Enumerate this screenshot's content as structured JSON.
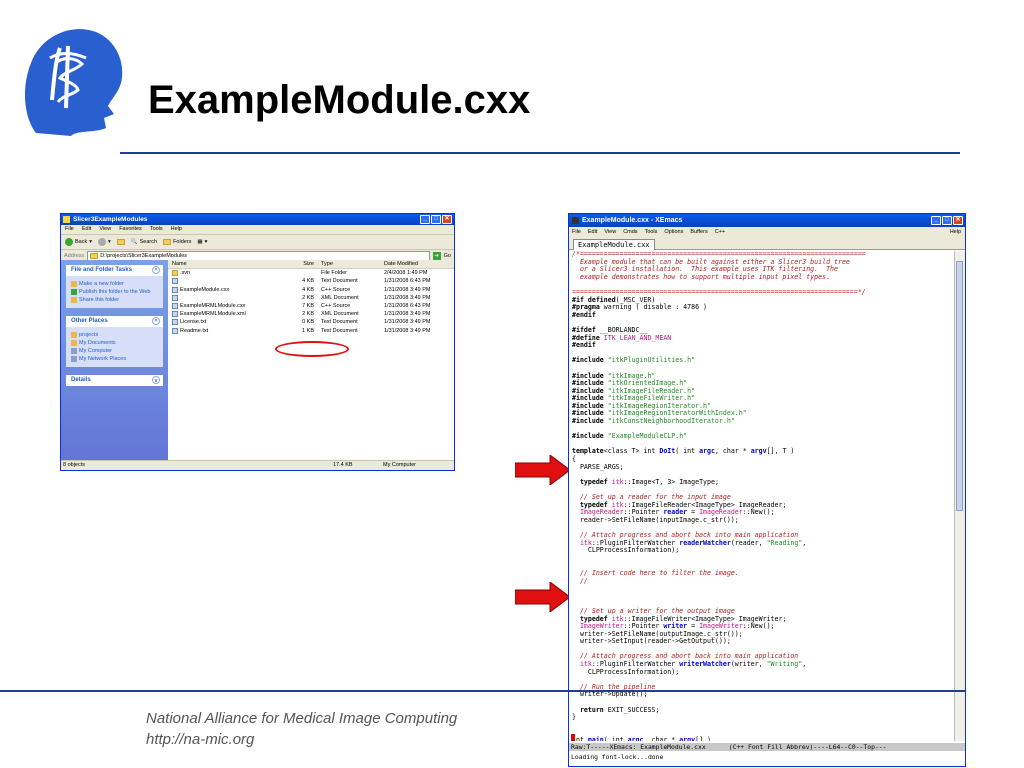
{
  "slide": {
    "title": "ExampleModule.cxx",
    "footer_line1": "National Alliance for Medical Image Computing",
    "footer_line2": "http://na-mic.org"
  },
  "explorer": {
    "title": "Slicer3ExampleModules",
    "menu": [
      "File",
      "Edit",
      "View",
      "Favorites",
      "Tools",
      "Help"
    ],
    "toolbar": {
      "back": "Back",
      "search": "Search",
      "folders": "Folders"
    },
    "address_label": "Address",
    "address_value": "D:\\projects\\Slicer3ExampleModules",
    "go_label": "Go",
    "tasks_header": "File and Folder Tasks",
    "tasks": [
      "Make a new folder",
      "Publish this folder to the Web",
      "Share this folder"
    ],
    "other_places_header": "Other Places",
    "other_places": [
      "projects",
      "My Documents",
      "My Computer",
      "My Network Places"
    ],
    "details_header": "Details",
    "columns": {
      "name": "Name",
      "size": "Size",
      "type": "Type",
      "date": "Date Modified"
    },
    "files": [
      {
        "name": ".svn",
        "size": "",
        "type": "File Folder",
        "date": "2/4/2008 1:49 PM",
        "folder": true
      },
      {
        "name": "",
        "size": "4 KB",
        "type": "Text Document",
        "date": "1/31/2008 6:43 PM"
      },
      {
        "name": "ExampleModule.cxx",
        "size": "4 KB",
        "type": "C++ Source",
        "date": "1/31/2008 3:49 PM"
      },
      {
        "name": "",
        "size": "2 KB",
        "type": "XML Document",
        "date": "1/31/2008 3:49 PM"
      },
      {
        "name": "ExampleMRMLModule.cxx",
        "size": "7 KB",
        "type": "C++ Source",
        "date": "1/31/2008 6:43 PM"
      },
      {
        "name": "ExampleMRMLModule.xml",
        "size": "2 KB",
        "type": "XML Document",
        "date": "1/31/2008 3:49 PM"
      },
      {
        "name": "License.txt",
        "size": "0 KB",
        "type": "Text Document",
        "date": "1/31/2008 3:49 PM"
      },
      {
        "name": "Readme.txt",
        "size": "1 KB",
        "type": "Text Document",
        "date": "1/31/2008 3:49 PM"
      }
    ],
    "status_objects": "8 objects",
    "status_size": "17.4 KB",
    "status_location": "My Computer"
  },
  "emacs": {
    "title": "ExampleModule.cxx - XEmacs",
    "menu": [
      "File",
      "Edit",
      "View",
      "Cmds",
      "Tools",
      "Options",
      "Buffers",
      "C++"
    ],
    "help": "Help",
    "tab": "ExampleModule.cxx",
    "modeline": "Raw:T-----XEmacs: ExampleModule.cxx      (C++ Font Fill Abbrev)----L64--C0--Top---",
    "echo": "Loading font-lock...done",
    "code": [
      [
        [
          "c",
          "/*========================================================================"
        ]
      ],
      [
        [
          "c",
          "  Example module that can be built against either a Slicer3 build tree"
        ]
      ],
      [
        [
          "c",
          "  or a Slicer3 installation.  This example uses ITK filtering.  The"
        ]
      ],
      [
        [
          "c",
          "  example demonstrates how to support multiple input pixel types."
        ]
      ],
      [
        [
          "n",
          ""
        ]
      ],
      [
        [
          "c",
          "========================================================================*/"
        ]
      ],
      [
        [
          "k",
          "#if defined"
        ],
        [
          "n",
          "(_MSC_VER)"
        ]
      ],
      [
        [
          "k",
          "#pragma"
        ],
        [
          "n",
          " warning ( disable : 4786 )"
        ]
      ],
      [
        [
          "k",
          "#endif"
        ]
      ],
      [
        [
          "n",
          ""
        ]
      ],
      [
        [
          "k",
          "#ifdef"
        ],
        [
          "n",
          " __BORLANDC__"
        ]
      ],
      [
        [
          "k",
          "#define"
        ],
        [
          "n",
          " "
        ],
        [
          "t",
          "ITK_LEAN_AND_MEAN"
        ]
      ],
      [
        [
          "k",
          "#endif"
        ]
      ],
      [
        [
          "n",
          ""
        ]
      ],
      [
        [
          "k",
          "#include"
        ],
        [
          "n",
          " "
        ],
        [
          "s",
          "\"itkPluginUtilities.h\""
        ]
      ],
      [
        [
          "n",
          ""
        ]
      ],
      [
        [
          "k",
          "#include"
        ],
        [
          "n",
          " "
        ],
        [
          "s",
          "\"itkImage.h\""
        ]
      ],
      [
        [
          "k",
          "#include"
        ],
        [
          "n",
          " "
        ],
        [
          "s",
          "\"itkOrientedImage.h\""
        ]
      ],
      [
        [
          "k",
          "#include"
        ],
        [
          "n",
          " "
        ],
        [
          "s",
          "\"itkImageFileReader.h\""
        ]
      ],
      [
        [
          "k",
          "#include"
        ],
        [
          "n",
          " "
        ],
        [
          "s",
          "\"itkImageFileWriter.h\""
        ]
      ],
      [
        [
          "k",
          "#include"
        ],
        [
          "n",
          " "
        ],
        [
          "s",
          "\"itkImageRegionIterator.h\""
        ]
      ],
      [
        [
          "k",
          "#include"
        ],
        [
          "n",
          " "
        ],
        [
          "s",
          "\"itkImageRegionIteratorWithIndex.h\""
        ]
      ],
      [
        [
          "k",
          "#include"
        ],
        [
          "n",
          " "
        ],
        [
          "s",
          "\"itkConstNeighborhoodIterator.h\""
        ]
      ],
      [
        [
          "n",
          ""
        ]
      ],
      [
        [
          "k",
          "#include"
        ],
        [
          "n",
          " "
        ],
        [
          "s",
          "\"ExampleModuleCLP.h\""
        ]
      ],
      [
        [
          "n",
          ""
        ]
      ],
      [
        [
          "k",
          "template"
        ],
        [
          "n",
          "<class T> int "
        ],
        [
          "f",
          "DoIt"
        ],
        [
          "n",
          "( int "
        ],
        [
          "f",
          "argc"
        ],
        [
          "n",
          ", char * "
        ],
        [
          "f",
          "argv"
        ],
        [
          "n",
          "[], T )"
        ]
      ],
      [
        [
          "n",
          "{"
        ]
      ],
      [
        [
          "n",
          "  PARSE_ARGS;"
        ]
      ],
      [
        [
          "n",
          ""
        ]
      ],
      [
        [
          "n",
          "  "
        ],
        [
          "k",
          "typedef"
        ],
        [
          "n",
          " "
        ],
        [
          "t",
          "itk"
        ],
        [
          "n",
          "::Image<T, 3> ImageType;"
        ]
      ],
      [
        [
          "n",
          ""
        ]
      ],
      [
        [
          "c",
          "  // Set up a reader for the input image"
        ]
      ],
      [
        [
          "n",
          "  "
        ],
        [
          "k",
          "typedef"
        ],
        [
          "n",
          " "
        ],
        [
          "t",
          "itk"
        ],
        [
          "n",
          "::ImageFileReader<ImageType> ImageReader;"
        ]
      ],
      [
        [
          "n",
          "  "
        ],
        [
          "t",
          "ImageReader"
        ],
        [
          "n",
          "::Pointer "
        ],
        [
          "f",
          "reader"
        ],
        [
          "n",
          " = "
        ],
        [
          "t",
          "ImageReader"
        ],
        [
          "n",
          "::New();"
        ]
      ],
      [
        [
          "n",
          "  reader->SetFileName(inputImage.c_str());"
        ]
      ],
      [
        [
          "n",
          ""
        ]
      ],
      [
        [
          "c",
          "  // Attach progress and abort back into main application"
        ]
      ],
      [
        [
          "n",
          "  "
        ],
        [
          "t",
          "itk"
        ],
        [
          "n",
          "::PluginFilterWatcher "
        ],
        [
          "f",
          "readerWatcher"
        ],
        [
          "n",
          "(reader, "
        ],
        [
          "s",
          "\"Reading\""
        ],
        [
          "n",
          ","
        ]
      ],
      [
        [
          "n",
          "    CLPProcessInformation);"
        ]
      ],
      [
        [
          "n",
          ""
        ]
      ],
      [
        [
          "n",
          ""
        ]
      ],
      [
        [
          "c",
          "  // Insert code here to filter the image."
        ]
      ],
      [
        [
          "c",
          "  //"
        ]
      ],
      [
        [
          "n",
          ""
        ]
      ],
      [
        [
          "n",
          ""
        ]
      ],
      [
        [
          "n",
          ""
        ]
      ],
      [
        [
          "c",
          "  // Set up a writer for the output image"
        ]
      ],
      [
        [
          "n",
          "  "
        ],
        [
          "k",
          "typedef"
        ],
        [
          "n",
          " "
        ],
        [
          "t",
          "itk"
        ],
        [
          "n",
          "::ImageFileWriter<ImageType> ImageWriter;"
        ]
      ],
      [
        [
          "n",
          "  "
        ],
        [
          "t",
          "ImageWriter"
        ],
        [
          "n",
          "::Pointer "
        ],
        [
          "f",
          "writer"
        ],
        [
          "n",
          " = "
        ],
        [
          "t",
          "ImageWriter"
        ],
        [
          "n",
          "::New();"
        ]
      ],
      [
        [
          "n",
          "  writer->SetFileName(outputImage.c_str());"
        ]
      ],
      [
        [
          "n",
          "  writer->SetInput(reader->GetOutput());"
        ]
      ],
      [
        [
          "n",
          ""
        ]
      ],
      [
        [
          "c",
          "  // Attach progress and abort back into main application"
        ]
      ],
      [
        [
          "n",
          "  "
        ],
        [
          "t",
          "itk"
        ],
        [
          "n",
          "::PluginFilterWatcher "
        ],
        [
          "f",
          "writerWatcher"
        ],
        [
          "n",
          "(writer, "
        ],
        [
          "s",
          "\"Writing\""
        ],
        [
          "n",
          ","
        ]
      ],
      [
        [
          "n",
          "    CLPProcessInformation);"
        ]
      ],
      [
        [
          "n",
          ""
        ]
      ],
      [
        [
          "c",
          "  // Run the pipeline"
        ]
      ],
      [
        [
          "n",
          "  writer->Update();"
        ]
      ],
      [
        [
          "n",
          ""
        ]
      ],
      [
        [
          "n",
          "  "
        ],
        [
          "k",
          "return"
        ],
        [
          "n",
          " EXIT_SUCCESS;"
        ]
      ],
      [
        [
          "n",
          "}"
        ]
      ],
      [
        [
          "n",
          ""
        ]
      ],
      [
        [
          "n",
          ""
        ]
      ],
      [
        [
          "n",
          "int "
        ],
        [
          "f",
          "main"
        ],
        [
          "n",
          "( int "
        ],
        [
          "f",
          "argc"
        ],
        [
          "n",
          ", char * "
        ],
        [
          "f",
          "argv"
        ],
        [
          "n",
          "[] )"
        ]
      ]
    ]
  }
}
